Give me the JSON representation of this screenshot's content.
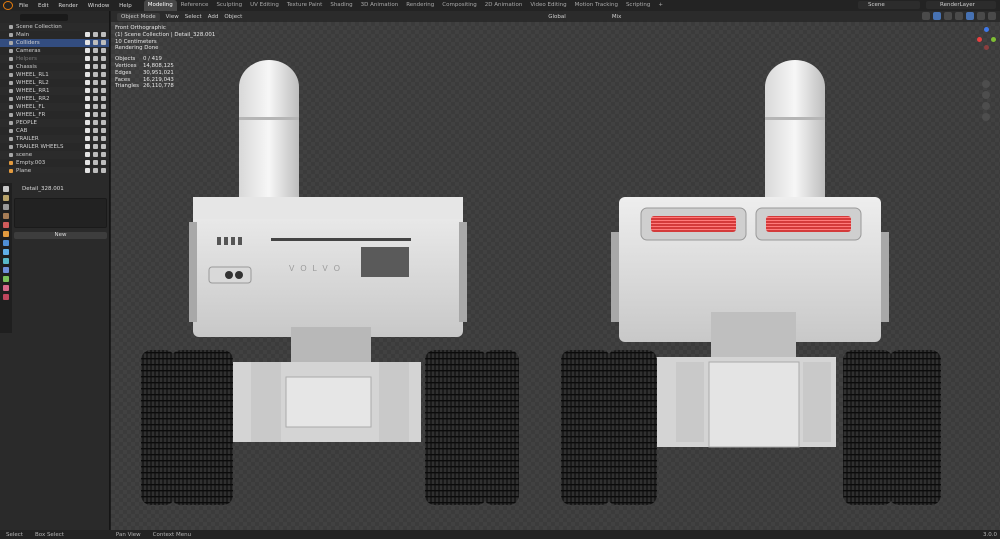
{
  "menu": {
    "items": [
      "File",
      "Edit",
      "Render",
      "Window",
      "Help"
    ]
  },
  "workspaces": [
    "Modeling",
    "Reference",
    "Sculpting",
    "UV Editing",
    "Texture Paint",
    "Shading",
    "3D Animation",
    "Rendering",
    "Compositing",
    "2D Animation",
    "Video Editing",
    "Motion Tracking",
    "Scripting",
    "+"
  ],
  "scene": {
    "label": "Scene",
    "layer": "RenderLayer"
  },
  "outliner": {
    "title": "Scene Collection",
    "rows": [
      {
        "label": "Main",
        "dim": false
      },
      {
        "label": "Colliders",
        "dim": false,
        "sel": true
      },
      {
        "label": "Cameras",
        "dim": false
      },
      {
        "label": "Helpers",
        "dim": true
      },
      {
        "label": "Chassis",
        "dim": false
      },
      {
        "label": "WHEEL_RL1",
        "dim": false
      },
      {
        "label": "WHEEL_RL2",
        "dim": false
      },
      {
        "label": "WHEEL_RR1",
        "dim": false
      },
      {
        "label": "WHEEL_RR2",
        "dim": false
      },
      {
        "label": "WHEEL_FL",
        "dim": false
      },
      {
        "label": "WHEEL_FR",
        "dim": false
      },
      {
        "label": "PEOPLE",
        "dim": false
      },
      {
        "label": "CAB",
        "dim": false
      },
      {
        "label": "TRAILER",
        "dim": false
      },
      {
        "label": "TRAILER WHEELS",
        "dim": false
      },
      {
        "label": "scene",
        "dim": false
      },
      {
        "label": "Empty.003",
        "dim": false,
        "obj": true
      },
      {
        "label": "Plane",
        "dim": false,
        "obj": true
      }
    ]
  },
  "properties": {
    "object_name": "Detail_328.001",
    "new_label": "New"
  },
  "viewport": {
    "mode": "Object Mode",
    "menus": [
      "View",
      "Select",
      "Add",
      "Object"
    ],
    "transform": "Global",
    "snap": "Mix",
    "overlay": {
      "view_name": "Front Orthographic",
      "collection": "(1) Scene Collection | Detail_328.001",
      "scale": "10 Centimeters",
      "status": "Rendering Done",
      "stats": [
        {
          "label": "Objects",
          "value": "0 / 419"
        },
        {
          "label": "Vertices",
          "value": "14,808,125"
        },
        {
          "label": "Edges",
          "value": "30,951,021"
        },
        {
          "label": "Faces",
          "value": "16,219,043"
        },
        {
          "label": "Triangles",
          "value": "26,110,778"
        }
      ]
    },
    "model_label": "VOLVO"
  },
  "statusbar": {
    "items": [
      "Select",
      "Box Select",
      "Pan View",
      "Context Menu"
    ],
    "version": "3.0.0"
  },
  "colors": {
    "accent": "#4772b3",
    "orange": "#e87d0d",
    "x_axis": "#e83f3f",
    "y_axis": "#7fbf33",
    "z_axis": "#3f78e8"
  }
}
